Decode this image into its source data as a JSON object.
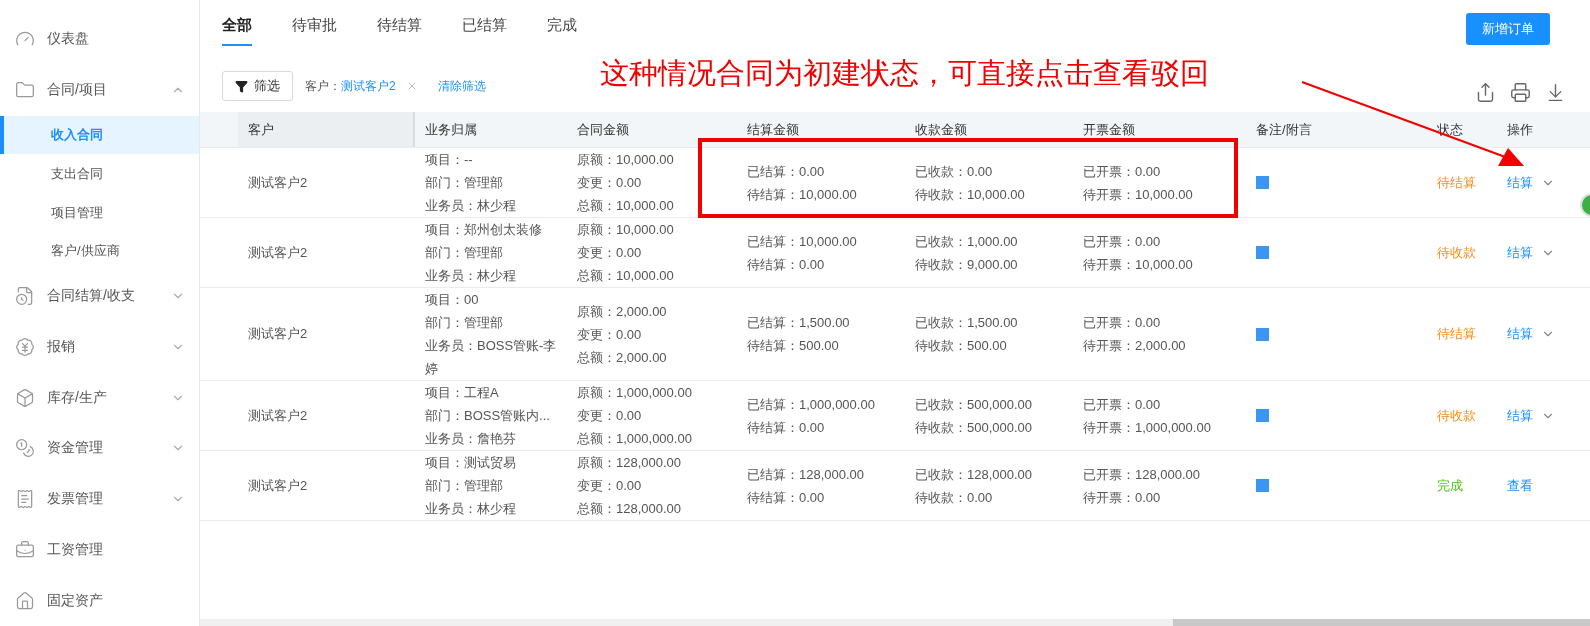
{
  "sidebar": {
    "items": [
      {
        "label": "仪表盘",
        "kind": "link"
      },
      {
        "label": "合同/项目",
        "kind": "group",
        "expanded": true,
        "children": [
          {
            "label": "收入合同",
            "selected": true
          },
          {
            "label": "支出合同",
            "selected": false
          },
          {
            "label": "项目管理",
            "selected": false
          },
          {
            "label": "客户/供应商",
            "selected": false
          }
        ]
      },
      {
        "label": "合同结算/收支",
        "kind": "group",
        "expanded": false
      },
      {
        "label": "报销",
        "kind": "group",
        "expanded": false
      },
      {
        "label": "库存/生产",
        "kind": "group",
        "expanded": false
      },
      {
        "label": "资金管理",
        "kind": "group",
        "expanded": false
      },
      {
        "label": "发票管理",
        "kind": "group",
        "expanded": false
      },
      {
        "label": "工资管理",
        "kind": "link"
      },
      {
        "label": "固定资产",
        "kind": "link"
      }
    ]
  },
  "tabs": [
    {
      "label": "全部",
      "selected": true
    },
    {
      "label": "待审批",
      "selected": false
    },
    {
      "label": "待结算",
      "selected": false
    },
    {
      "label": "已结算",
      "selected": false
    },
    {
      "label": "完成",
      "selected": false
    }
  ],
  "new_button": "新增订单",
  "filter": {
    "button": "筛选",
    "chip_label": "客户：",
    "chip_value": "测试客户2",
    "clear": "清除筛选"
  },
  "annotation": {
    "text": "这种情况合同为初建状态，可直接点击查看驳回"
  },
  "table": {
    "columns": [
      "客户",
      "业务归属",
      "合同金额",
      "结算金额",
      "收款金额",
      "开票金额",
      "备注/附言",
      "状态",
      "操作"
    ],
    "rows": [
      {
        "customer": "测试客户2",
        "business": [
          "项目：--",
          "部门：管理部",
          "业务员：林少程"
        ],
        "amount": [
          "原额：10,000.00",
          "变更：0.00",
          "总额：10,000.00"
        ],
        "settle": [
          "已结算：0.00",
          "待结算：10,000.00"
        ],
        "receive": [
          "已收款：0.00",
          "待收款：10,000.00"
        ],
        "invoice": [
          "已开票：0.00",
          "待开票：10,000.00"
        ],
        "status": {
          "text": "待结算",
          "kind": "pending"
        },
        "action": {
          "label": "结算",
          "menu": true
        }
      },
      {
        "customer": "测试客户2",
        "business": [
          "项目：郑州创太装修",
          "部门：管理部",
          "业务员：林少程"
        ],
        "amount": [
          "原额：10,000.00",
          "变更：0.00",
          "总额：10,000.00"
        ],
        "settle": [
          "已结算：10,000.00",
          "待结算：0.00"
        ],
        "receive": [
          "已收款：1,000.00",
          "待收款：9,000.00"
        ],
        "invoice": [
          "已开票：0.00",
          "待开票：10,000.00"
        ],
        "status": {
          "text": "待收款",
          "kind": "pending"
        },
        "action": {
          "label": "结算",
          "menu": true
        }
      },
      {
        "customer": "测试客户2",
        "business": [
          "项目：00",
          "部门：管理部",
          "业务员：BOSS管账-李婷"
        ],
        "amount": [
          "原额：2,000.00",
          "变更：0.00",
          "总额：2,000.00"
        ],
        "settle": [
          "已结算：1,500.00",
          "待结算：500.00"
        ],
        "receive": [
          "已收款：1,500.00",
          "待收款：500.00"
        ],
        "invoice": [
          "已开票：0.00",
          "待开票：2,000.00"
        ],
        "status": {
          "text": "待结算",
          "kind": "pending"
        },
        "action": {
          "label": "结算",
          "menu": true
        }
      },
      {
        "customer": "测试客户2",
        "business": [
          "项目：工程A",
          "部门：BOSS管账内...",
          "业务员：詹艳芬"
        ],
        "amount": [
          "原额：1,000,000.00",
          "变更：0.00",
          "总额：1,000,000.00"
        ],
        "settle": [
          "已结算：1,000,000.00",
          "待结算：0.00"
        ],
        "receive": [
          "已收款：500,000.00",
          "待收款：500,000.00"
        ],
        "invoice": [
          "已开票：0.00",
          "待开票：1,000,000.00"
        ],
        "status": {
          "text": "待收款",
          "kind": "pending"
        },
        "action": {
          "label": "结算",
          "menu": true
        }
      },
      {
        "customer": "测试客户2",
        "business": [
          "项目：测试贸易",
          "部门：管理部",
          "业务员：林少程"
        ],
        "amount": [
          "原额：128,000.00",
          "变更：0.00",
          "总额：128,000.00"
        ],
        "settle": [
          "已结算：128,000.00",
          "待结算：0.00"
        ],
        "receive": [
          "已收款：128,000.00",
          "待收款：0.00"
        ],
        "invoice": [
          "已开票：128,000.00",
          "待开票：0.00"
        ],
        "status": {
          "text": "完成",
          "kind": "done"
        },
        "action": {
          "label": "查看",
          "menu": false
        }
      }
    ]
  }
}
